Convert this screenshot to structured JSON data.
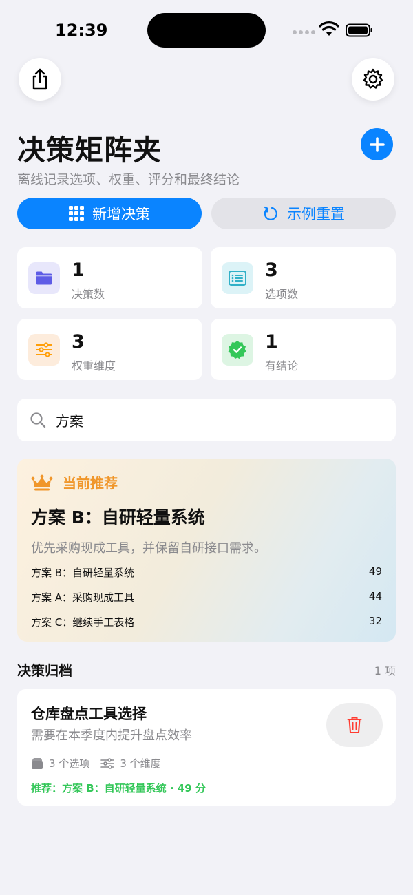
{
  "status": {
    "time": "12:39"
  },
  "header": {
    "title": "决策矩阵夹",
    "subtitle": "离线记录选项、权重、评分和最终结论"
  },
  "actions": {
    "new_label": "新增决策",
    "reset_label": "示例重置"
  },
  "stats": [
    {
      "value": "1",
      "label": "决策数",
      "icon": "folder-icon",
      "color": "#5e5ce6"
    },
    {
      "value": "3",
      "label": "选项数",
      "icon": "list-icon",
      "color": "#30b0c7"
    },
    {
      "value": "3",
      "label": "权重维度",
      "icon": "sliders-icon",
      "color": "#ff9f0a"
    },
    {
      "value": "1",
      "label": "有结论",
      "icon": "verified-badge-icon",
      "color": "#34c759"
    }
  ],
  "search": {
    "value": "方案",
    "placeholder": ""
  },
  "recommendation": {
    "label": "当前推荐",
    "title": "方案 B：自研轻量系统",
    "description": "优先采购现成工具，并保留自研接口需求。",
    "rankings": [
      {
        "name": "方案 B：自研轻量系统",
        "score": "49"
      },
      {
        "name": "方案 A：采购现成工具",
        "score": "44"
      },
      {
        "name": "方案 C：继续手工表格",
        "score": "32"
      }
    ]
  },
  "archive": {
    "title": "决策归档",
    "count": "1 项",
    "items": [
      {
        "title": "仓库盘点工具选择",
        "description": "需要在本季度内提升盘点效率",
        "options": "3 个选项",
        "dimensions": "3 个维度",
        "recommendation": "推荐：方案 B：自研轻量系统 · 49 分"
      }
    ]
  },
  "colors": {
    "accent": "#0a84ff",
    "recommend": "#f0962a",
    "success": "#34c759",
    "danger": "#ff3b30"
  }
}
